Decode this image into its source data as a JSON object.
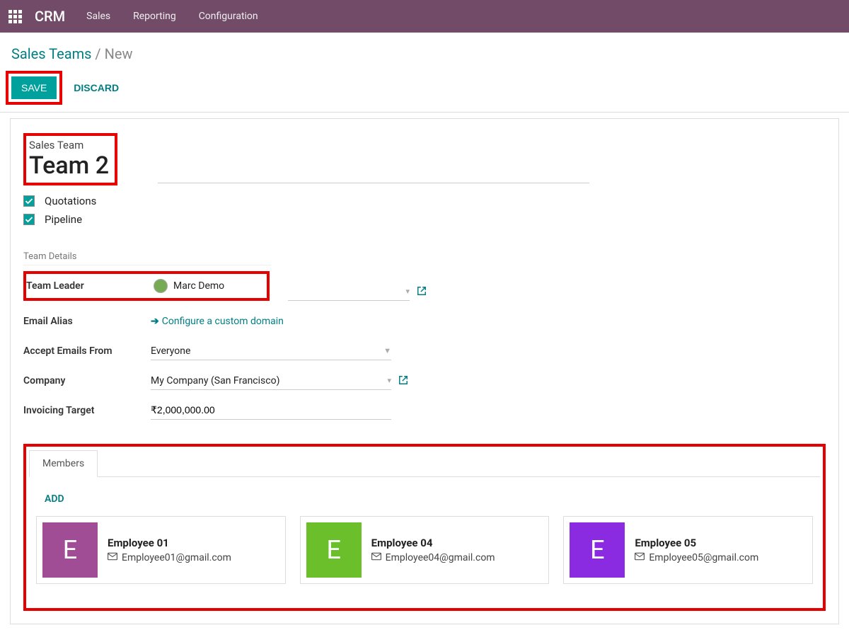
{
  "nav": {
    "brand": "CRM",
    "items": [
      "Sales",
      "Reporting",
      "Configuration"
    ]
  },
  "breadcrumb": {
    "root": "Sales Teams",
    "current": "New"
  },
  "actions": {
    "save": "SAVE",
    "discard": "DISCARD"
  },
  "form": {
    "name_label": "Sales Team",
    "name_value": "Team 2",
    "checks": {
      "quotations": "Quotations",
      "pipeline": "Pipeline"
    },
    "section_title": "Team Details",
    "team_leader": {
      "label": "Team Leader",
      "value": "Marc Demo"
    },
    "email_alias": {
      "label": "Email Alias",
      "config_link": "Configure a custom domain"
    },
    "accept_from": {
      "label": "Accept Emails From",
      "value": "Everyone"
    },
    "company": {
      "label": "Company",
      "value": "My Company (San Francisco)"
    },
    "invoicing": {
      "label": "Invoicing Target",
      "value": "₹2,000,000.00"
    }
  },
  "members": {
    "tab": "Members",
    "add": "ADD",
    "cards": [
      {
        "name": "Employee 01",
        "email": "Employee01@gmail.com",
        "initial": "E",
        "color": "#a14d96"
      },
      {
        "name": "Employee 04",
        "email": "Employee04@gmail.com",
        "initial": "E",
        "color": "#6bbf2b"
      },
      {
        "name": "Employee 05",
        "email": "Employee05@gmail.com",
        "initial": "E",
        "color": "#8a2be2"
      }
    ]
  }
}
